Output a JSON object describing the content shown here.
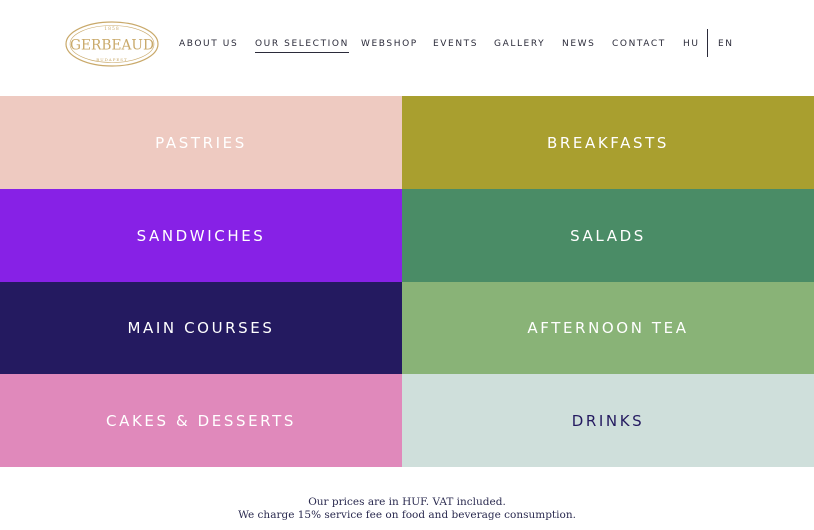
{
  "brand": {
    "name": "GERBEAUD",
    "year": "1858",
    "city": "BUDAPEST",
    "logo_color": "#c9a96a"
  },
  "nav": {
    "items": [
      {
        "label": "ABOUT US"
      },
      {
        "label": "OUR SELECTION",
        "active": true
      },
      {
        "label": "WEBSHOP"
      },
      {
        "label": "EVENTS"
      },
      {
        "label": "GALLERY"
      },
      {
        "label": "NEWS"
      },
      {
        "label": "CONTACT"
      }
    ],
    "languages": [
      "HU",
      "EN"
    ]
  },
  "categories": [
    {
      "label": "PASTRIES",
      "bg": "#eecac1",
      "fg": "#ffffff"
    },
    {
      "label": "BREAKFASTS",
      "bg": "#a99f2f",
      "fg": "#ffffff"
    },
    {
      "label": "SANDWICHES",
      "bg": "#8721e6",
      "fg": "#ffffff"
    },
    {
      "label": "SALADS",
      "bg": "#4a8c66",
      "fg": "#ffffff"
    },
    {
      "label": "MAIN COURSES",
      "bg": "#241a60",
      "fg": "#ffffff"
    },
    {
      "label": "AFTERNOON TEA",
      "bg": "#89b377",
      "fg": "#ffffff"
    },
    {
      "label": "CAKES & DESSERTS",
      "bg": "#e089bb",
      "fg": "#ffffff"
    },
    {
      "label": "DRINKS",
      "bg": "#cfdfdb",
      "fg": "#241a60"
    }
  ],
  "footer": {
    "line1": "Our prices are in HUF. VAT included.",
    "line2": "We charge 15% service fee on food and beverage consumption."
  }
}
